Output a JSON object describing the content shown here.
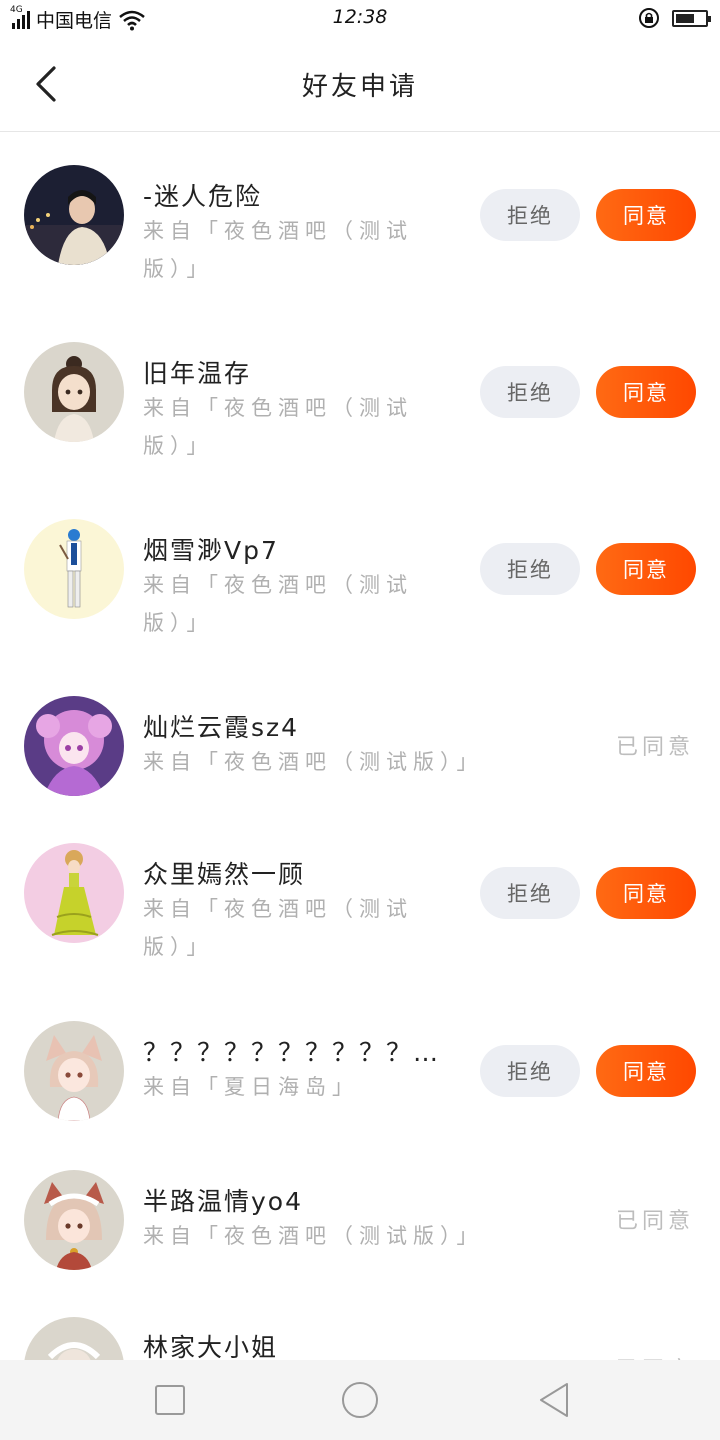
{
  "status_bar": {
    "network": "4G",
    "carrier": "中国电信",
    "time": "12:38",
    "battery_level": 0.65
  },
  "header": {
    "title": "好友申请",
    "back_icon": "chevron-left-icon"
  },
  "actions": {
    "reject_label": "拒绝",
    "accept_label": "同意",
    "agreed_label": "已同意"
  },
  "requests": [
    {
      "name": "-迷人危险",
      "from": "来自「夜色酒吧（测试版）」",
      "status": "pending"
    },
    {
      "name": "旧年温存",
      "from": "来自「夜色酒吧（测试版）」",
      "status": "pending"
    },
    {
      "name": "烟雪渺Vp7",
      "from": "来自「夜色酒吧（测试版）」",
      "status": "pending"
    },
    {
      "name": "灿烂云霞sz4",
      "from": "来自「夜色酒吧（测试版）」",
      "status": "agreed"
    },
    {
      "name": "众里嫣然一顾",
      "from": "来自「夜色酒吧（测试版）」",
      "status": "pending"
    },
    {
      "name": "？？？？？？？？？？…",
      "from": "来自「夏日海岛」",
      "status": "pending"
    },
    {
      "name": "半路温情yo4",
      "from": "来自「夜色酒吧（测试版）」",
      "status": "agreed"
    },
    {
      "name": "林家大小姐",
      "from": "",
      "status": "agreed"
    }
  ],
  "nav_bar": {
    "recents_icon": "square-icon",
    "home_icon": "circle-icon",
    "back_icon": "triangle-back-icon"
  },
  "colors": {
    "accent": "#ff5a0a",
    "reject_bg": "#eceef3",
    "muted_text": "#b0b0b0"
  }
}
